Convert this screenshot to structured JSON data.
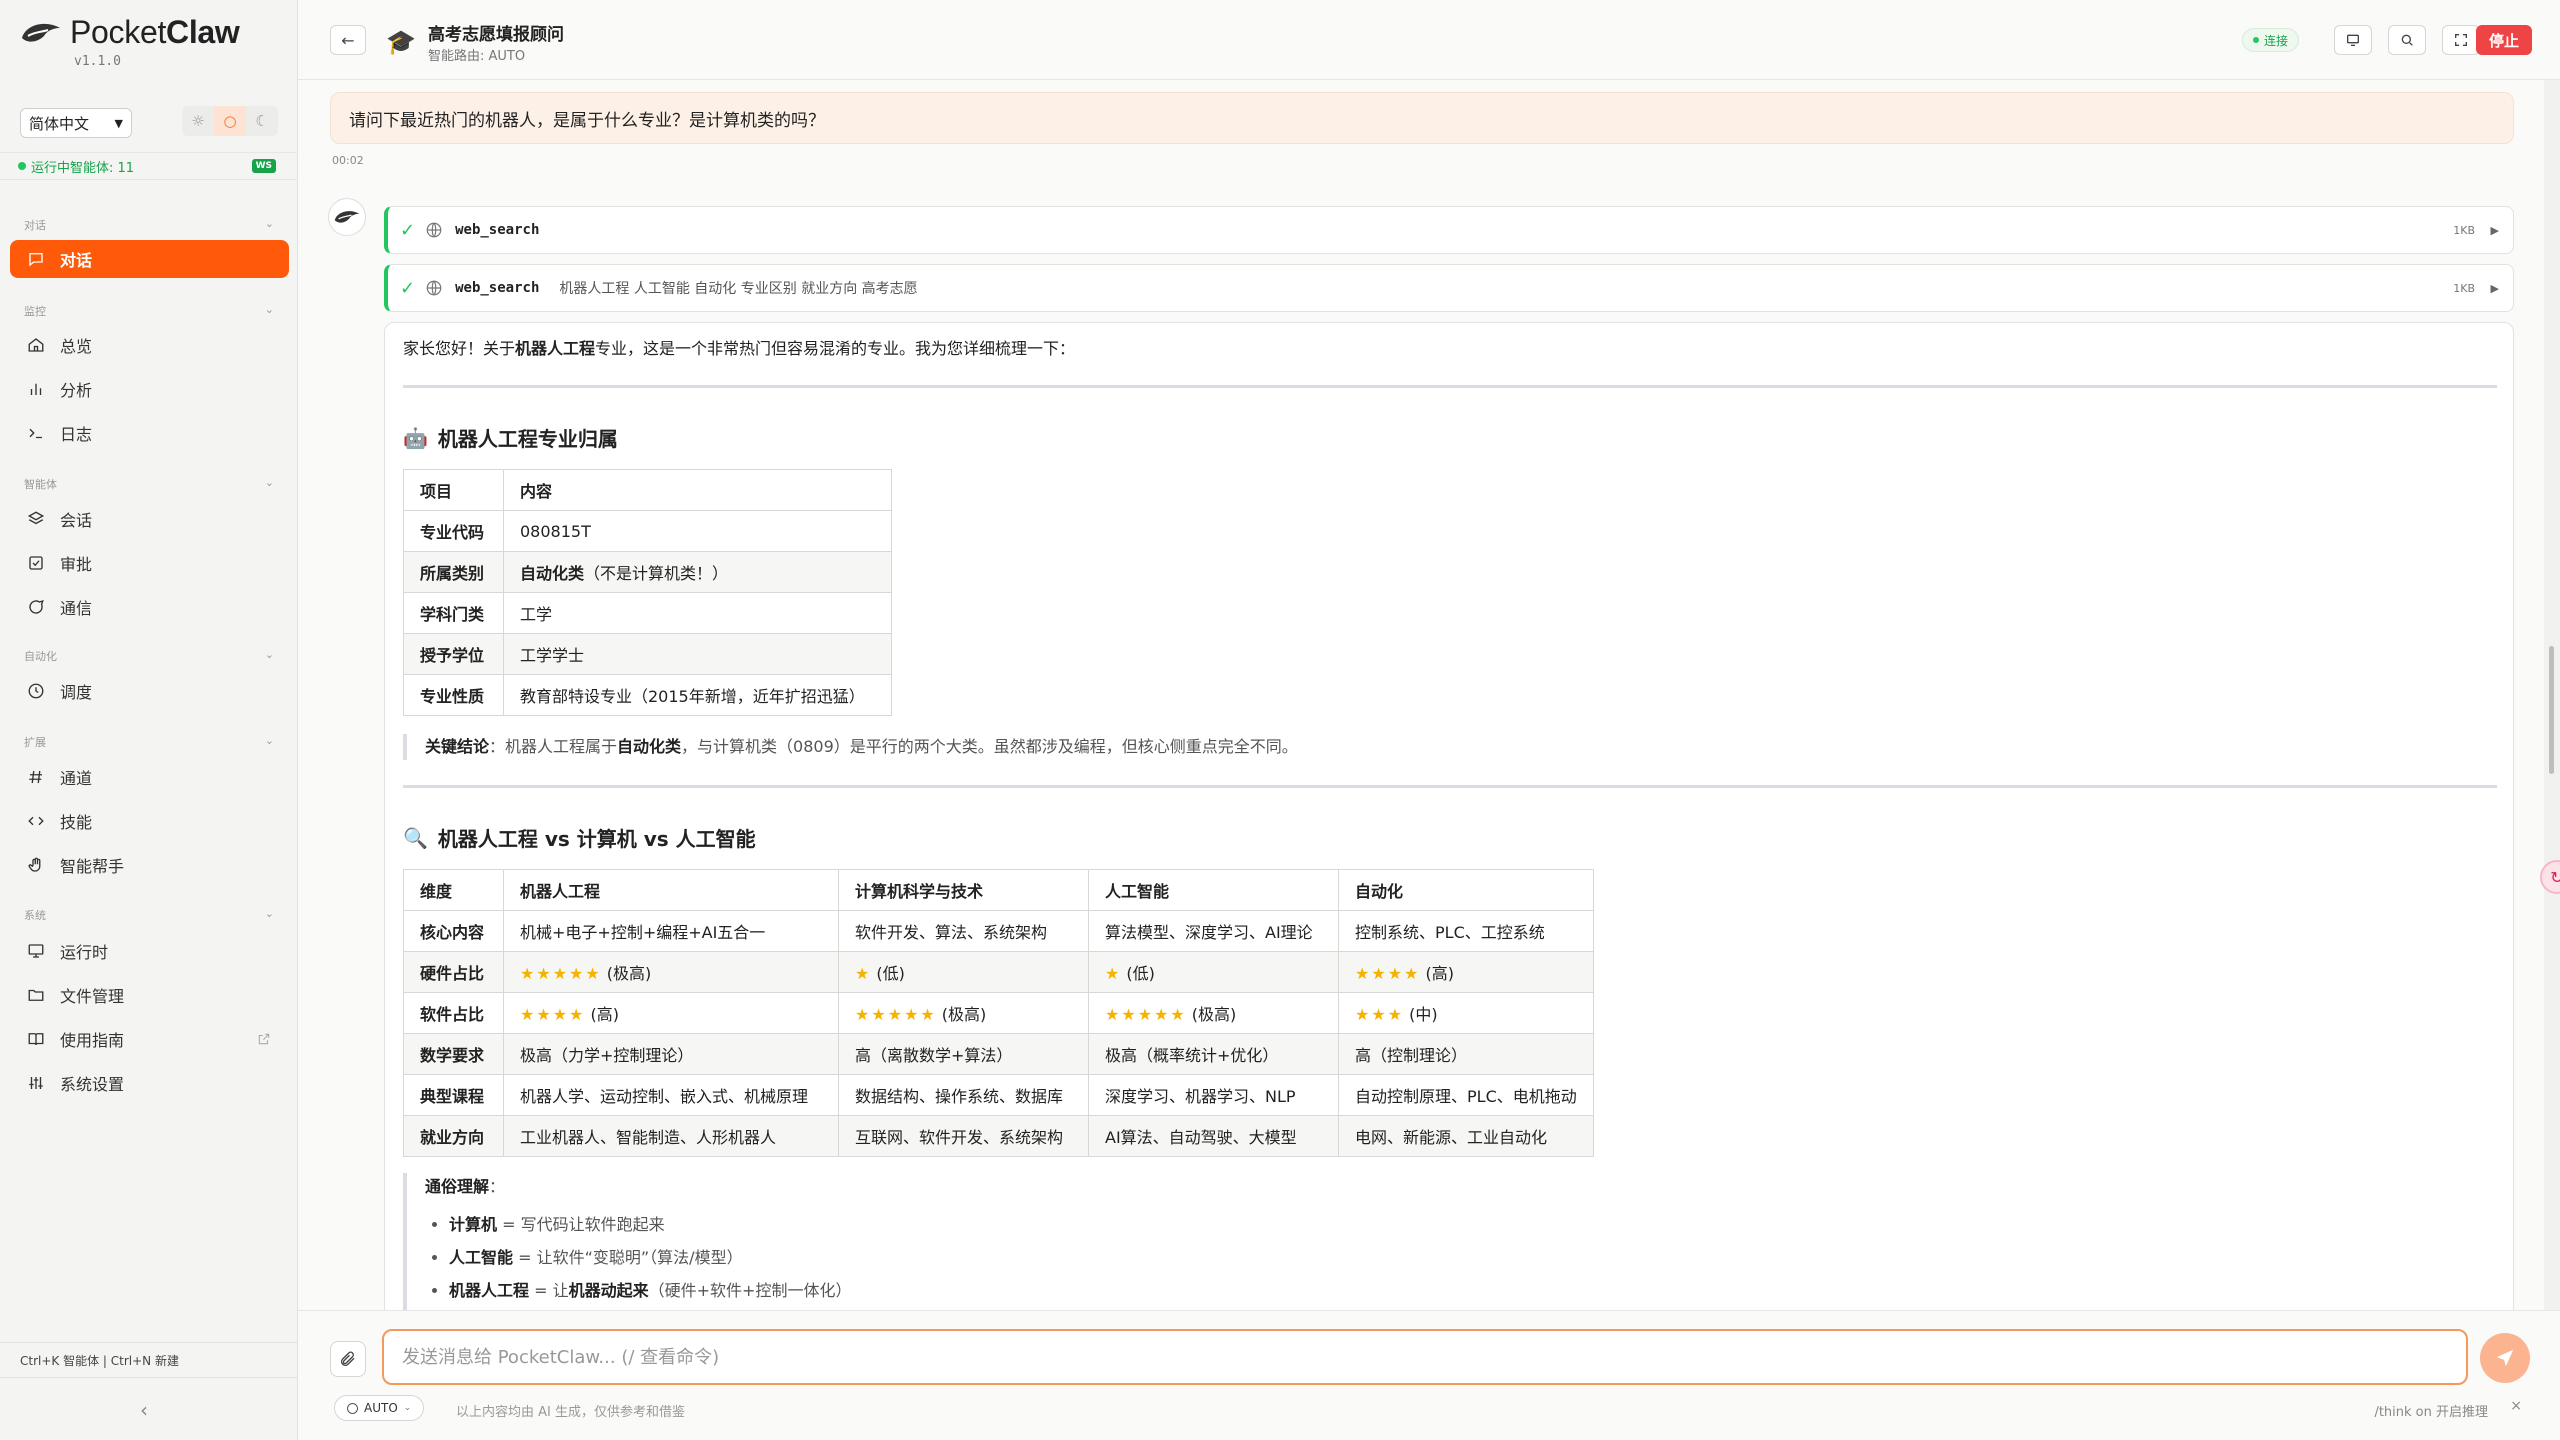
{
  "brand": {
    "name_light": "Pocket",
    "name_bold": "Claw",
    "version": "v1.1.0"
  },
  "sidebar": {
    "language": "简体中文",
    "theme_icons": {
      "light": "☼",
      "auto": "○",
      "dark": "☾"
    },
    "status": "运行中智能体: 11",
    "ws_badge": "WS",
    "sections": {
      "chat": "对话",
      "monitor": "监控",
      "agents": "智能体",
      "automation": "自动化",
      "extensions": "扩展",
      "system": "系统"
    },
    "items": {
      "chat": "对话",
      "overview": "总览",
      "analytics": "分析",
      "logs": "日志",
      "sessions": "会话",
      "approvals": "审批",
      "comms": "通信",
      "schedule": "调度",
      "channels": "通道",
      "skills": "技能",
      "assistant": "智能帮手",
      "runtime": "运行时",
      "files": "文件管理",
      "guide": "使用指南",
      "settings": "系统设置"
    },
    "shortcuts": "Ctrl+K 智能体 | Ctrl+N 新建",
    "collapse": "‹"
  },
  "header": {
    "back": "←",
    "agent_emoji": "🎓",
    "title": "高考志愿填报顾问",
    "subtitle": "智能路由: AUTO",
    "connection": "连接",
    "stop": "停止"
  },
  "chat": {
    "user_message": "请问下最近热门的机器人，是属于什么专业？是计算机类的吗？",
    "time": "00:02",
    "tools": [
      {
        "name": "web_search",
        "args": "",
        "size": "1KB"
      },
      {
        "name": "web_search",
        "args": "机器人工程 人工智能 自动化 专业区别 就业方向 高考志愿",
        "size": "1KB"
      }
    ],
    "answer": {
      "intro_pre": "家长您好！关于",
      "intro_bold": "机器人工程",
      "intro_post": "专业，这是一个非常热门但容易混淆的专业。我为您详细梳理一下：",
      "section1": {
        "emoji": "🤖",
        "title": "机器人工程专业归属"
      },
      "table1": {
        "headers": [
          "项目",
          "内容"
        ],
        "rows": [
          [
            "专业代码",
            "080815T"
          ],
          [
            "所属类别",
            "自动化类",
            "（不是计算机类！）"
          ],
          [
            "学科门类",
            "工学"
          ],
          [
            "授予学位",
            "工学学士"
          ],
          [
            "专业性质",
            "教育部特设专业（2015年新增，近年扩招迅猛）"
          ]
        ]
      },
      "conclusion": {
        "label": "关键结论",
        "pre": "：机器人工程属于",
        "bold": "自动化类",
        "post": "，与计算机类（0809）是平行的两个大类。虽然都涉及编程，但核心侧重点完全不同。"
      },
      "section2": {
        "emoji": "🔍",
        "title": "机器人工程 vs 计算机 vs 人工智能"
      },
      "table2": {
        "headers": [
          "维度",
          "机器人工程",
          "计算机科学与技术",
          "人工智能",
          "自动化"
        ],
        "rows": [
          [
            "核心内容",
            "机械+电子+控制+编程+AI五合一",
            "软件开发、算法、系统架构",
            "算法模型、深度学习、AI理论",
            "控制系统、PLC、工控系统"
          ],
          [
            "硬件占比",
            "★★★★★ (极高)",
            "★ (低)",
            "★ (低)",
            "★★★★ (高)"
          ],
          [
            "软件占比",
            "★★★★ (高)",
            "★★★★★ (极高)",
            "★★★★★ (极高)",
            "★★★ (中)"
          ],
          [
            "数学要求",
            "极高（力学+控制理论）",
            "高（离散数学+算法）",
            "极高（概率统计+优化）",
            "高（控制理论）"
          ],
          [
            "典型课程",
            "机器人学、运动控制、嵌入式、机械原理",
            "数据结构、操作系统、数据库",
            "深度学习、机器学习、NLP",
            "自动控制原理、PLC、电机拖动"
          ],
          [
            "就业方向",
            "工业机器人、智能制造、人形机器人",
            "互联网、软件开发、系统架构",
            "AI算法、自动驾驶、大模型",
            "电网、新能源、工业自动化"
          ]
        ]
      },
      "plain": {
        "title": "通俗理解",
        "items": [
          {
            "bold": "计算机",
            "text": " = 写代码让软件跑起来"
          },
          {
            "bold": "人工智能",
            "text": " = 让软件“变聪明”（算法/模型）"
          },
          {
            "bold": "机器人工程",
            "text": " = 让",
            "bold2": "机器动起来",
            "text2": "（硬件+软件+控制一体化）"
          }
        ]
      }
    }
  },
  "composer": {
    "placeholder": "发送消息给 PocketClaw... (/ 查看命令)",
    "route": "AUTO",
    "disclaimer": "以上内容均由 AI 生成，仅供参考和借鉴",
    "think_hint": "/think on 开启推理",
    "close": "×"
  },
  "colors": {
    "accent": "#ff5a0a",
    "success": "#22c55e",
    "danger": "#ef4444",
    "star": "#f5b300"
  }
}
